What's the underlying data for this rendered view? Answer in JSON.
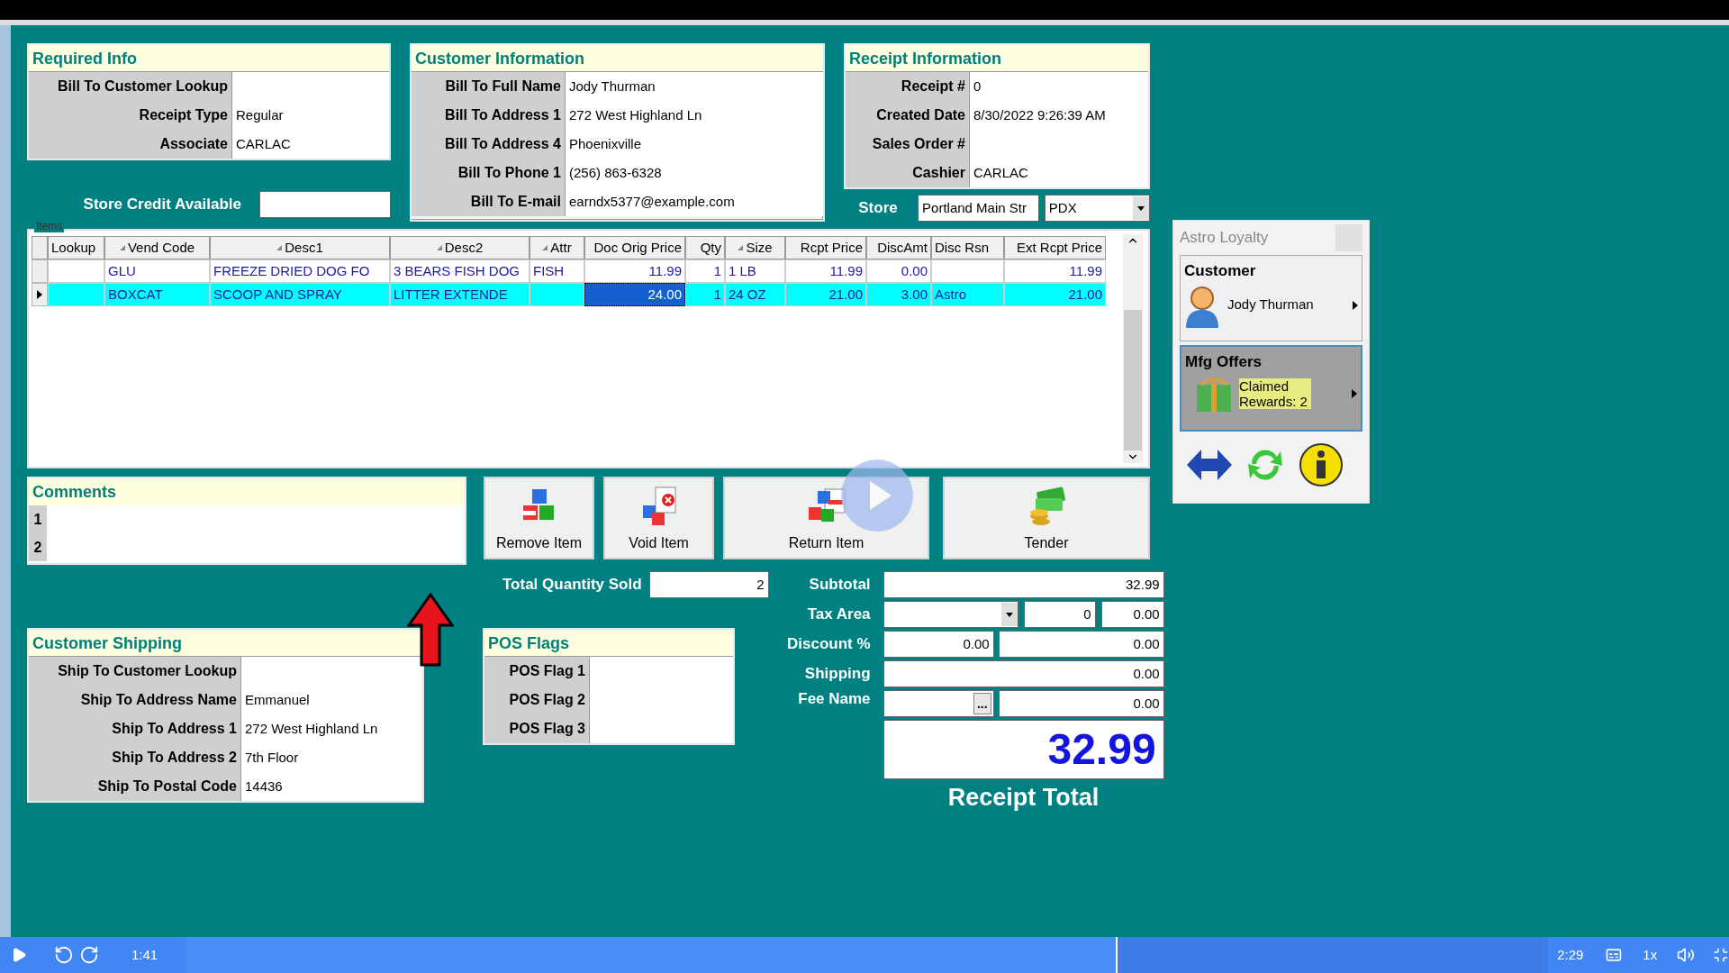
{
  "required_info": {
    "title": "Required Info",
    "rows": [
      {
        "label": "Bill To Customer Lookup"
      },
      {
        "label": "Receipt Type",
        "value": "Regular"
      },
      {
        "label": "Associate",
        "value": "CARLAC"
      }
    ]
  },
  "store_credit": {
    "label": "Store Credit Available"
  },
  "customer_information": {
    "title": "Customer Information",
    "rows": [
      {
        "label": "Bill To Full Name",
        "value": "Jody Thurman"
      },
      {
        "label": "Bill To Address 1",
        "value": "272 West Highland Ln"
      },
      {
        "label": "Bill To Address 4",
        "value": "Phoenixville"
      },
      {
        "label": "Bill To Phone 1",
        "value": "(256) 863-6328"
      },
      {
        "label": "Bill To E-mail",
        "value": "earndx5377@example.com"
      }
    ]
  },
  "receipt_information": {
    "title": "Receipt Information",
    "rows": [
      {
        "label": "Receipt #",
        "value": "0"
      },
      {
        "label": "Created Date",
        "value": "8/30/2022 9:26:39 AM"
      },
      {
        "label": "Sales Order #"
      },
      {
        "label": "Cashier",
        "value": "CARLAC"
      }
    ]
  },
  "store": {
    "label": "Store",
    "name": "Portland Main Str",
    "code": "PDX"
  },
  "items": {
    "legend": "Items",
    "columns": [
      {
        "label": "Lookup",
        "sortable": false,
        "kind": "text"
      },
      {
        "label": "Vend Code",
        "sortable": true,
        "kind": "text"
      },
      {
        "label": "Desc1",
        "sortable": true,
        "kind": "text"
      },
      {
        "label": "Desc2",
        "sortable": true,
        "kind": "text"
      },
      {
        "label": "Attr",
        "sortable": true,
        "kind": "text"
      },
      {
        "label": "Doc Orig Price",
        "sortable": false,
        "kind": "number"
      },
      {
        "label": "Qty",
        "sortable": false,
        "kind": "number"
      },
      {
        "label": "Size",
        "sortable": true,
        "kind": "text"
      },
      {
        "label": "Rcpt Price",
        "sortable": false,
        "kind": "number"
      },
      {
        "label": "DiscAmt",
        "sortable": false,
        "kind": "number"
      },
      {
        "label": "Disc Rsn",
        "sortable": false,
        "kind": "text"
      },
      {
        "label": "Ext Rcpt Price",
        "sortable": false,
        "kind": "number"
      }
    ],
    "rows": [
      {
        "selected": false,
        "cells": [
          {
            "selected": false
          },
          {
            "text": "GLU",
            "selected": false
          },
          {
            "text": "FREEZE DRIED DOG FO",
            "selected": false
          },
          {
            "text": "3 BEARS FISH DOG",
            "selected": false
          },
          {
            "text": "FISH",
            "selected": false
          },
          {
            "text": "11.99",
            "selected": false
          },
          {
            "text": "1",
            "selected": false
          },
          {
            "text": "1 LB",
            "selected": false
          },
          {
            "text": "11.99",
            "selected": false
          },
          {
            "text": "0.00",
            "selected": false
          },
          {
            "selected": false
          },
          {
            "text": "11.99",
            "selected": false
          }
        ]
      },
      {
        "selected": true,
        "cells": [
          {
            "selected": false
          },
          {
            "text": "BOXCAT",
            "selected": false
          },
          {
            "text": "SCOOP AND SPRAY",
            "selected": false
          },
          {
            "text": "LITTER EXTENDE",
            "selected": false
          },
          {
            "selected": false
          },
          {
            "text": "24.00",
            "selected": true
          },
          {
            "text": "1",
            "selected": false
          },
          {
            "text": "24 OZ",
            "selected": false
          },
          {
            "text": "21.00",
            "selected": false
          },
          {
            "text": "3.00",
            "selected": false
          },
          {
            "text": "Astro",
            "selected": false
          },
          {
            "text": "21.00",
            "selected": false
          }
        ]
      }
    ]
  },
  "comments": {
    "title": "Comments",
    "lines": [
      "1",
      "2"
    ]
  },
  "actions": [
    {
      "label": "Remove Item",
      "kind": "remove"
    },
    {
      "label": "Void Item",
      "kind": "void"
    },
    {
      "label": "Return Item",
      "kind": "return"
    },
    {
      "label": "Tender",
      "kind": "tender"
    }
  ],
  "quantity": {
    "label": "Total Quantity Sold",
    "value": "2"
  },
  "totals": {
    "subtotal": {
      "label": "Subtotal",
      "value": "32.99"
    },
    "tax": {
      "label": "Tax Area",
      "rate": "0",
      "amount": "0.00"
    },
    "discount": {
      "label": "Discount %",
      "percent": "0.00",
      "amount": "0.00"
    },
    "shipping": {
      "label": "Shipping",
      "value": "0.00"
    },
    "fee": {
      "label": "Fee Name",
      "button": "...",
      "amount": "0.00"
    },
    "total": {
      "value": "32.99",
      "label": "Receipt Total"
    }
  },
  "customer_shipping": {
    "title": "Customer Shipping",
    "rows": [
      {
        "label": "Ship To Customer Lookup"
      },
      {
        "label": "Ship To Address Name",
        "value": "Emmanuel"
      },
      {
        "label": "Ship To Address 1",
        "value": "272 West Highland Ln"
      },
      {
        "label": "Ship To Address 2",
        "value": "7th Floor"
      },
      {
        "label": "Ship To Postal Code",
        "value": "14436"
      }
    ]
  },
  "pos_flags": {
    "title": "POS Flags",
    "rows": [
      {
        "label": "POS Flag 1"
      },
      {
        "label": "POS Flag 2"
      },
      {
        "label": "POS Flag 3"
      }
    ]
  },
  "loyalty": {
    "title": "Astro Loyalty",
    "customer": {
      "title": "Customer",
      "name": "Jody Thurman",
      "selected": false
    },
    "offers": {
      "title": "Mfg Offers",
      "text": "Claimed Rewards: 2",
      "selected": true
    }
  },
  "player": {
    "elapsed": "1:41",
    "duration": "2:29",
    "speed": "1x",
    "level": 0.684
  }
}
